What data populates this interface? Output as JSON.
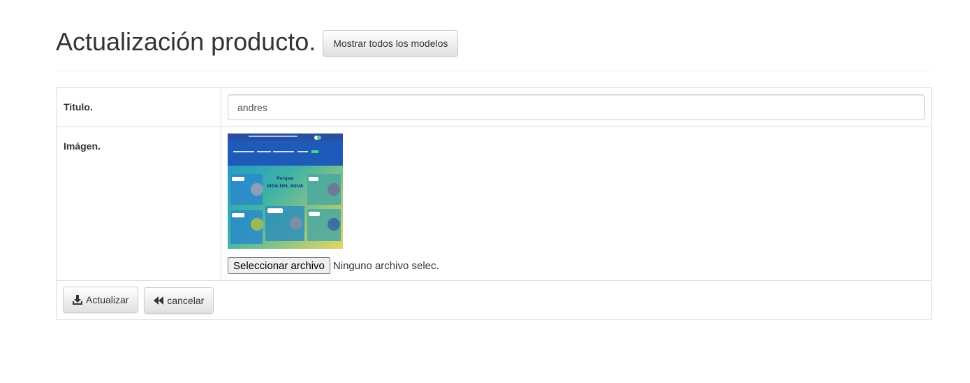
{
  "header": {
    "title": "Actualización producto.",
    "show_models_label": "Mostrar todos los modelos"
  },
  "form": {
    "title_label": "Titulo.",
    "title_value": "andres",
    "image_label": "Imágen.",
    "file_button_label": "Seleccionar archivo",
    "file_status": "Ninguno archivo selec."
  },
  "actions": {
    "update_label": "Actualizar",
    "update_icon": "download-icon",
    "cancel_label": "cancelar",
    "cancel_icon": "fast-backward-icon"
  },
  "thumbnail": {
    "heading": "Parque",
    "subheading": "VIDA DEL AGUA",
    "card_labels": [
      "La planta",
      "Recursos",
      "Calidad del agua",
      "Cuanto falta",
      "Al aire libre"
    ]
  },
  "colors": {
    "text": "#333333",
    "border": "#dddddd",
    "thumb_blue": "#1e5bb8",
    "thumb_teal": "#2fa3a0",
    "thumb_yellow": "#e2d86a"
  }
}
